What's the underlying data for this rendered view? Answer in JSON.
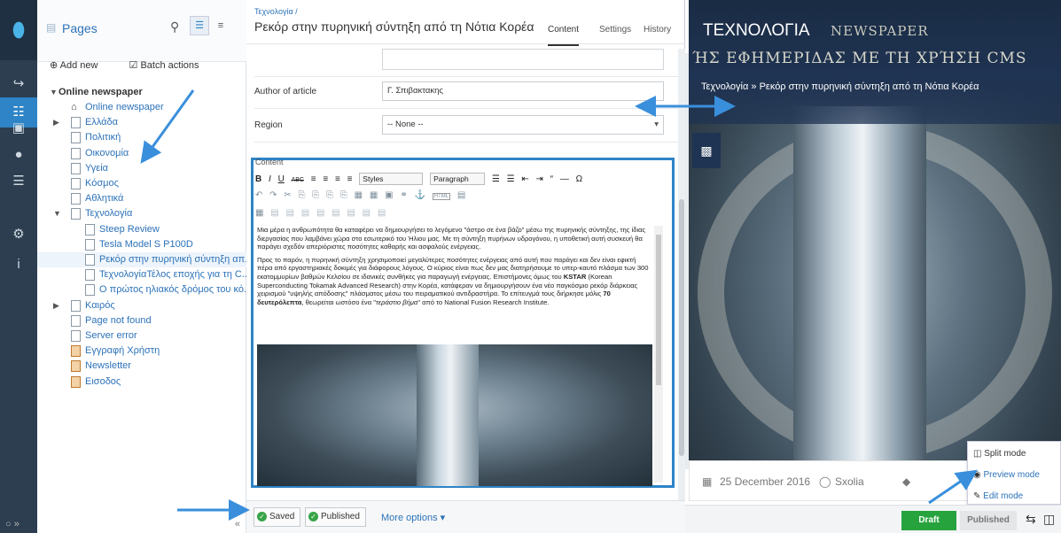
{
  "menu": {
    "logo": "⬮",
    "items": [
      "↪",
      "☷",
      "▣",
      "●",
      "☰",
      "⚙",
      "i"
    ],
    "bottom": "○ »"
  },
  "tree": {
    "title": "Pages",
    "add_new": "Add new",
    "batch_actions": "Batch actions",
    "root": "Online newspaper",
    "collapse": "«",
    "items": [
      {
        "label": "Online newspaper",
        "level": 1,
        "icon": "home"
      },
      {
        "label": "Ελλάδα",
        "level": 1,
        "icon": "page",
        "arrow": "right"
      },
      {
        "label": "Πολιτική",
        "level": 1,
        "icon": "page"
      },
      {
        "label": "Οικονομία",
        "level": 1,
        "icon": "page"
      },
      {
        "label": "Υγεία",
        "level": 1,
        "icon": "page"
      },
      {
        "label": "Κόσμος",
        "level": 1,
        "icon": "page"
      },
      {
        "label": "Αθλητικά",
        "level": 1,
        "icon": "page"
      },
      {
        "label": "Τεχνολογία",
        "level": 1,
        "icon": "page",
        "arrow": "down"
      },
      {
        "label": "Steep Review",
        "level": 2,
        "icon": "page"
      },
      {
        "label": "Tesla Model S P100D",
        "level": 2,
        "icon": "page"
      },
      {
        "label": "Ρεκόρ στην πυρηνική σύντηξη απ...",
        "level": 2,
        "icon": "page",
        "selected": true
      },
      {
        "label": "ΤεχνολογίαΤέλος εποχής για τη C...",
        "level": 2,
        "icon": "page"
      },
      {
        "label": "Ο πρώτος ηλιακός δρόμος του κό...",
        "level": 2,
        "icon": "page"
      },
      {
        "label": "Καιρός",
        "level": 1,
        "icon": "page",
        "arrow": "right"
      },
      {
        "label": "Page not found",
        "level": 1,
        "icon": "page"
      },
      {
        "label": "Server error",
        "level": 1,
        "icon": "page"
      },
      {
        "label": "Εγγραφή Χρήστη",
        "level": 1,
        "icon": "red"
      },
      {
        "label": "Newsletter",
        "level": 1,
        "icon": "red"
      },
      {
        "label": "Εισοδος",
        "level": 1,
        "icon": "red"
      }
    ]
  },
  "editor": {
    "breadcrumb": "Τεχνολογία /",
    "title": "Ρεκόρ στην πυρηνική σύντηξη από τη Νότια Κορέα",
    "tabs": [
      "Content",
      "Settings",
      "History"
    ],
    "author_label": "Author of article",
    "author_value": "Γ. Σπιβακτακης",
    "region_label": "Region",
    "region_value": "-- None --",
    "content_label": "Content",
    "toolbar_styles": "Styles",
    "toolbar_paragraph": "Paragraph",
    "toolbar_row1": [
      "B",
      "I",
      "U",
      "ABC",
      "≡",
      "≡",
      "≡",
      "≡"
    ],
    "toolbar_row1b": [
      "☰",
      "☰",
      "⇤",
      "⇥",
      "“",
      "—",
      "Ω"
    ],
    "toolbar_row2": [
      "↶",
      "↷",
      "✂",
      "⎘",
      "⎘",
      "⎘",
      "⎘",
      "▦",
      "▦",
      "▣",
      "⚭",
      "⚓",
      "HTML",
      "▤"
    ],
    "toolbar_row3": [
      "▦",
      "▤",
      "▤",
      "▤",
      "▤",
      "▤",
      "▤",
      "▤",
      "▤"
    ],
    "para1": "Μια μέρα η ανθρωπότητα θα καταφέρει να δημιουργήσει το λεγόμενο \"άστρο σε ένα βάζο\" μέσω της πυρηνικής σύντηξης, της ίδιας διεργασίας που λαμβάνει χώρα στο εσωτερικό του Ήλιου μας. Με τη σύντηξη πυρήνων υδρογόνου, η υποθετική αυτή συσκευή θα παράγει σχεδόν απεριόριστες ποσότητες καθαρής και ασφαλούς ενέργειας.",
    "para2a": "Προς το παρόν, η πυρηνική σύντηξη χρησιμοποιεί μεγαλύτερες ποσότητες ενέργειας από αυτή που παράγει και δεν είναι εφικτή πέρα από εργαστηριακές δοκιμές για διάφορους λόγους. Ο κύριος είναι πως δεν μας διατηρήσουμε το υπερ-καυτό πλάσμα των 300 εκατομμυρίων βαθμών Κελσίου σε ιδανικές συνθήκες για παραγωγή ενέργειας. Επιστήμονες όμως του",
    "para2_bold1": "KSTAR",
    "para2b": "(Korean Superconducting Tokamak Advanced Research) στην Κορέα, κατάφεραν να δημιουργήσουν ένα νέο παγκόσμιο ρεκόρ διάρκειας χειρισμού \"υψηλής απόδοσης\" πλάσματος μέσω του πειραματικού αντιδραστήρα. Το επίτευγμά τους διήρκησε μόλις",
    "para2_bold2": "70 δευτερόλεπτα",
    "para2c": ", θεωρείται ωστόσο ένα \"",
    "para2_italic": "τεράστιο βήμα",
    "para2d": "\" από το National Fusion Research Institute."
  },
  "footer": {
    "saved": "Saved",
    "published": "Published",
    "more_options": "More options ▾"
  },
  "preview": {
    "section_title": "ΤΕΧΝΟΛΟΓΙΑ",
    "bg_text1": "NEWSPAPER",
    "bg_text2": "ΉΣ ΕΦΗΜΕΡΙΔΑΣ ΜΕ ΤΗ ΧΡΉΣΗ CMS",
    "breadcrumb": "Τεχνολογία » Ρεκόρ στην πυρηνική σύντηξη από τη Νότια Κορέα",
    "date": "25 December 2016",
    "comments": "Sxolia",
    "modes": [
      "Split mode",
      "Preview mode",
      "Edit mode"
    ],
    "draft": "Draft",
    "published": "Published",
    "colors": {
      "accent": "#2e84c7",
      "draft": "#27a33e"
    }
  }
}
